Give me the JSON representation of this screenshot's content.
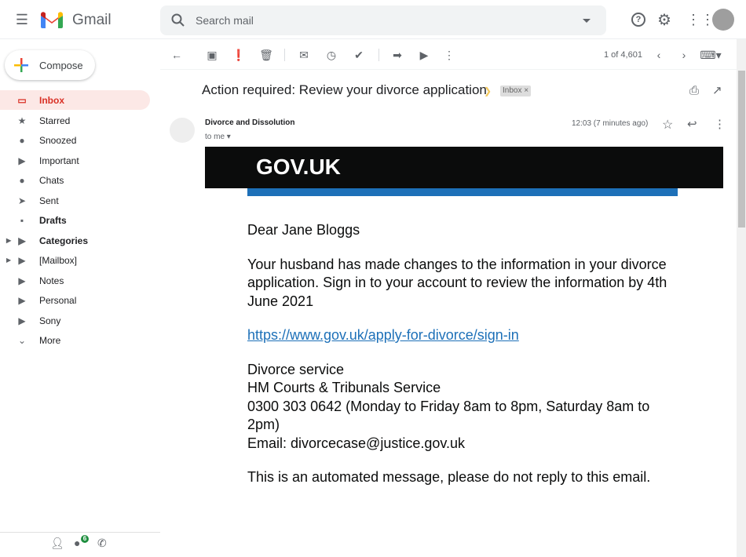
{
  "app": {
    "name": "Gmail"
  },
  "search": {
    "placeholder": "Search mail"
  },
  "compose": {
    "label": "Compose"
  },
  "sidebar": {
    "items": [
      {
        "label": "Inbox",
        "icon": "inbox-icon"
      },
      {
        "label": "Starred",
        "icon": "star-icon"
      },
      {
        "label": "Snoozed",
        "icon": "clock-icon"
      },
      {
        "label": "Important",
        "icon": "important-icon"
      },
      {
        "label": "Chats",
        "icon": "chat-icon"
      },
      {
        "label": "Sent",
        "icon": "send-icon"
      },
      {
        "label": "Drafts",
        "icon": "draft-icon"
      },
      {
        "label": "Categories",
        "icon": "label-icon"
      },
      {
        "label": "[Mailbox]",
        "icon": "label-icon"
      },
      {
        "label": "Notes",
        "icon": "label-icon"
      },
      {
        "label": "Personal",
        "icon": "label-icon"
      },
      {
        "label": "Sony",
        "icon": "label-icon"
      },
      {
        "label": "More",
        "icon": "chevron-down-icon"
      }
    ]
  },
  "footer": {
    "chat_badge": "6"
  },
  "toolbar": {
    "pagination": "1 of 4,601"
  },
  "email": {
    "subject": "Action required: Review your divorce application",
    "label": "Inbox",
    "label_close": "×",
    "sender": "Divorce and Dissolution",
    "recipient": "to me",
    "time": "12:03 (7 minutes ago)",
    "banner": "GOV.UK",
    "greeting": "Dear Jane Bloggs",
    "paragraph": "Your husband has made changes to the information in your divorce application. Sign in to your account to review the information by 4th June 2021",
    "link": "https://www.gov.uk/apply-for-divorce/sign-in",
    "sig": [
      "Divorce service",
      "HM Courts & Tribunals Service",
      "0300 303 0642 (Monday to Friday 8am to 8pm, Saturday 8am to 2pm)",
      "Email: divorcecase@justice.gov.uk"
    ],
    "footer_note": "This is an automated message, please do not reply to this email."
  },
  "colors": {
    "banner": "#0b0c0c",
    "blue_bar": "#1d70b8",
    "link": "#1d70b8",
    "active": "#d93025"
  }
}
